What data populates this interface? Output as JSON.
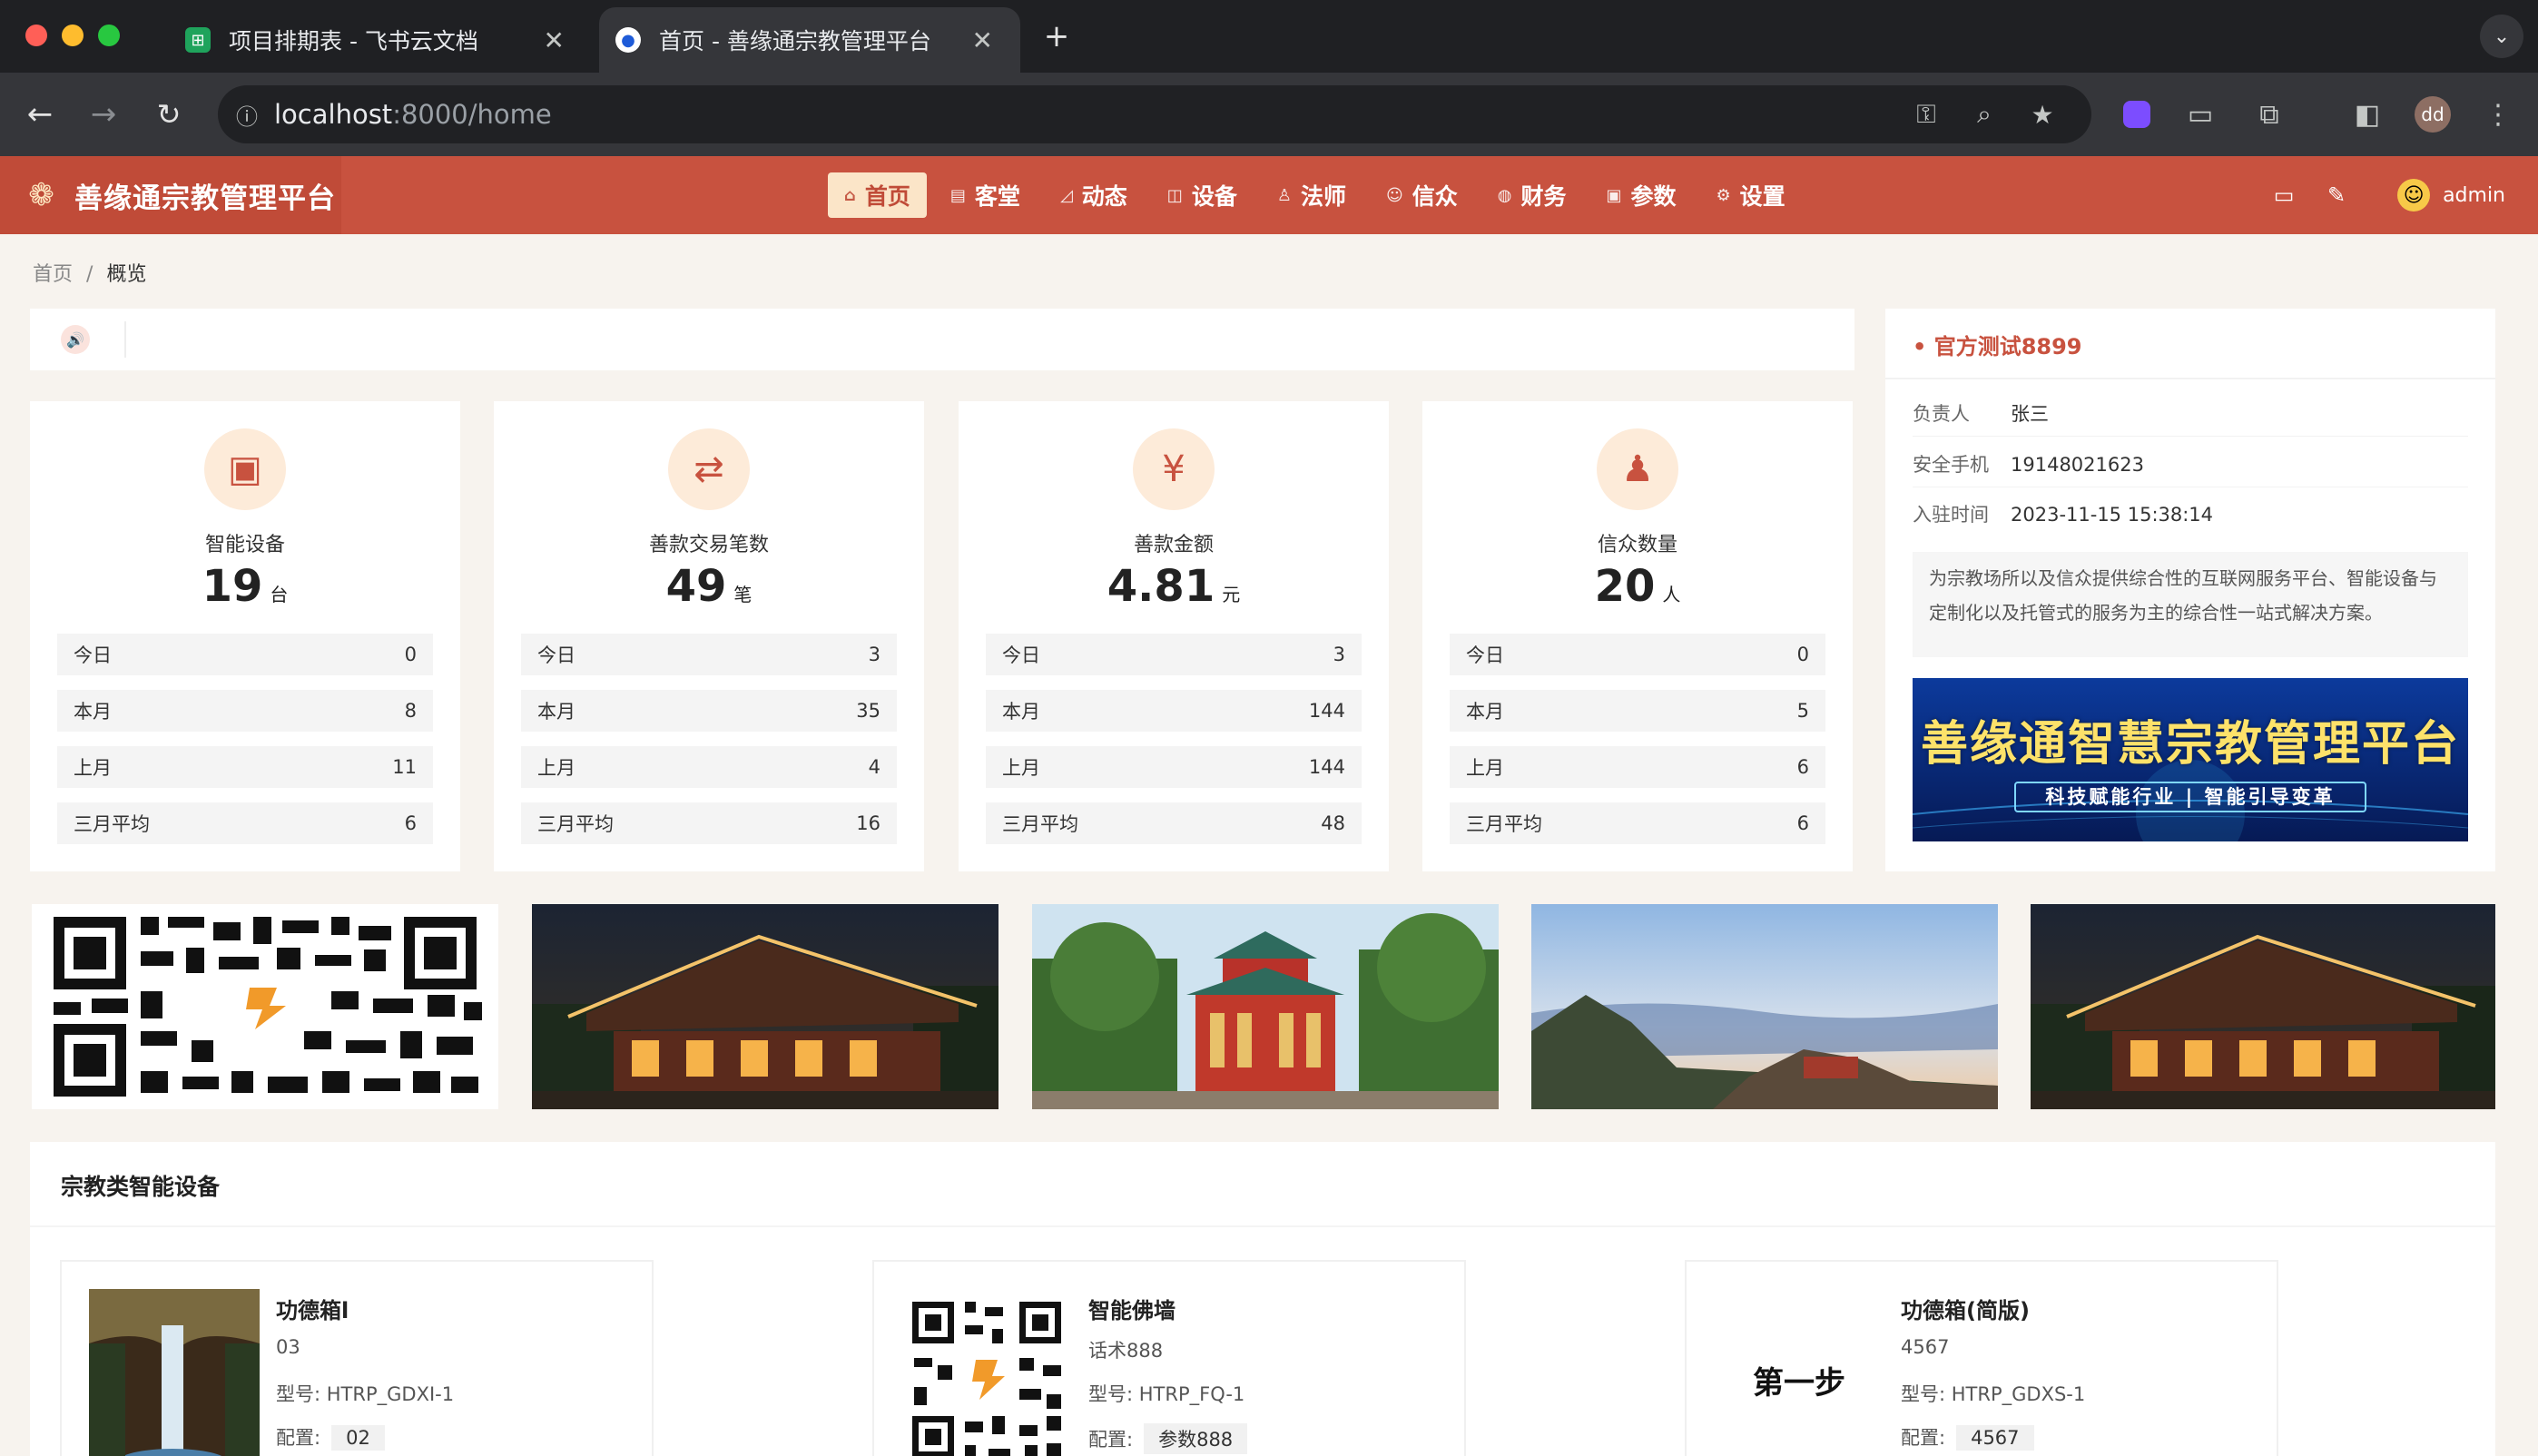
{
  "browser": {
    "tabs": [
      {
        "title": "项目排期表 - 飞书云文档",
        "active": false
      },
      {
        "title": "首页 - 善缘通宗教管理平台",
        "active": true
      }
    ],
    "url_host": "localhost",
    "url_rest": ":8000/home",
    "profile": "dd"
  },
  "header": {
    "brand": "善缘通宗教管理平台",
    "menu": [
      {
        "label": "首页",
        "icon": "home-icon"
      },
      {
        "label": "客堂",
        "icon": "hall-icon"
      },
      {
        "label": "动态",
        "icon": "activity-icon"
      },
      {
        "label": "设备",
        "icon": "device-icon"
      },
      {
        "label": "法师",
        "icon": "master-icon"
      },
      {
        "label": "信众",
        "icon": "believer-icon"
      },
      {
        "label": "财务",
        "icon": "finance-icon"
      },
      {
        "label": "参数",
        "icon": "params-icon"
      },
      {
        "label": "设置",
        "icon": "settings-icon"
      }
    ],
    "user": "admin"
  },
  "breadcrumb": {
    "home": "首页",
    "sep": "/",
    "current": "概览"
  },
  "stats": [
    {
      "title": "智能设备",
      "value": "19",
      "unit": "台",
      "rows": [
        [
          "今日",
          "0"
        ],
        [
          "本月",
          "8"
        ],
        [
          "上月",
          "11"
        ],
        [
          "三月平均",
          "6"
        ]
      ]
    },
    {
      "title": "善款交易笔数",
      "value": "49",
      "unit": "笔",
      "rows": [
        [
          "今日",
          "3"
        ],
        [
          "本月",
          "35"
        ],
        [
          "上月",
          "4"
        ],
        [
          "三月平均",
          "16"
        ]
      ]
    },
    {
      "title": "善款金额",
      "value": "4.81",
      "unit": "元",
      "rows": [
        [
          "今日",
          "3"
        ],
        [
          "本月",
          "144"
        ],
        [
          "上月",
          "144"
        ],
        [
          "三月平均",
          "48"
        ]
      ]
    },
    {
      "title": "信众数量",
      "value": "20",
      "unit": "人",
      "rows": [
        [
          "今日",
          "0"
        ],
        [
          "本月",
          "5"
        ],
        [
          "上月",
          "6"
        ],
        [
          "三月平均",
          "6"
        ]
      ]
    }
  ],
  "org": {
    "name": "• 官方测试8899",
    "contact_label": "负责人",
    "contact": "张三",
    "phone_label": "安全手机",
    "phone": "19148021623",
    "joined_label": "入驻时间",
    "joined": "2023-11-15 15:38:14",
    "description": "为宗教场所以及信众提供综合性的互联网服务平台、智能设备与定制化以及托管式的服务为主的综合性一站式解决方案。",
    "banner_title": "善缘通智慧宗教管理平台",
    "banner_sub": "科技赋能行业 | 智能引导变革"
  },
  "equipment": {
    "title": "宗教类智能设备",
    "model_label": "型号: ",
    "config_label": "配置:",
    "items": [
      {
        "name": "功德箱l",
        "code": "03",
        "model": "HTRP_GDXI-1",
        "config": "02"
      },
      {
        "name": "智能佛墙",
        "code": "话术888",
        "model": "HTRP_FQ-1",
        "config": "参数888"
      },
      {
        "name": "功德箱(简版)",
        "code": "4567",
        "model": "HTRP_GDXS-1",
        "config": "4567",
        "image_text": "第一步"
      }
    ]
  }
}
